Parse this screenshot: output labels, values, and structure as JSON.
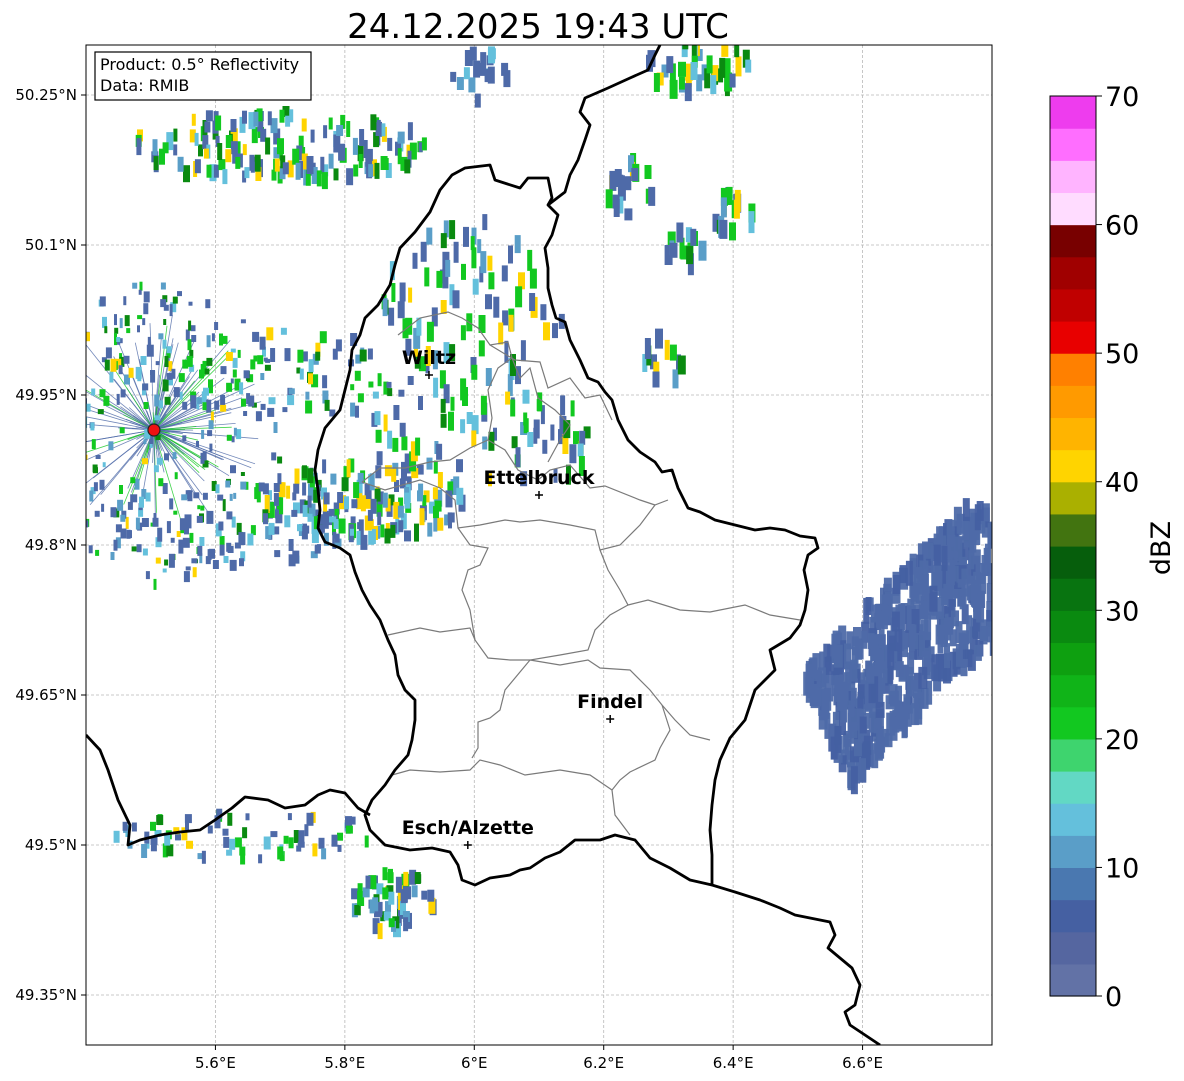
{
  "title": "24.12.2025 19:43 UTC",
  "info_box": {
    "product": "Product: 0.5° Reflectivity",
    "data": "Data: RMIB"
  },
  "axes": {
    "lon_ticks": [
      {
        "value": 5.6,
        "label": "5.6°E"
      },
      {
        "value": 5.8,
        "label": "5.8°E"
      },
      {
        "value": 6.0,
        "label": "6°E"
      },
      {
        "value": 6.2,
        "label": "6.2°E"
      },
      {
        "value": 6.4,
        "label": "6.4°E"
      },
      {
        "value": 6.6,
        "label": "6.6°E"
      }
    ],
    "lat_ticks": [
      {
        "value": 50.25,
        "label": "50.25°N"
      },
      {
        "value": 50.1,
        "label": "50.1°N"
      },
      {
        "value": 49.95,
        "label": "49.95°N"
      },
      {
        "value": 49.8,
        "label": "49.8°N"
      },
      {
        "value": 49.65,
        "label": "49.65°N"
      },
      {
        "value": 49.5,
        "label": "49.5°N"
      },
      {
        "value": 49.35,
        "label": "49.35°N"
      }
    ],
    "lon_range": [
      5.4,
      6.8
    ],
    "lat_range": [
      49.3,
      50.3
    ]
  },
  "cities": [
    {
      "name": "Wiltz",
      "lon": 5.93,
      "lat": 49.97
    },
    {
      "name": "Ettelbruck",
      "lon": 6.1,
      "lat": 49.85
    },
    {
      "name": "Findel",
      "lon": 6.21,
      "lat": 49.626
    },
    {
      "name": "Esch/Alzette",
      "lon": 5.99,
      "lat": 49.5
    }
  ],
  "radar_site": {
    "lon": 5.505,
    "lat": 49.915,
    "color": "#ee1111"
  },
  "colorbar": {
    "label": "dBZ",
    "min": 0,
    "max": 70,
    "ticks": [
      {
        "value": 0,
        "label": "0"
      },
      {
        "value": 10,
        "label": "10"
      },
      {
        "value": 20,
        "label": "20"
      },
      {
        "value": 30,
        "label": "30"
      },
      {
        "value": 40,
        "label": "40"
      },
      {
        "value": 50,
        "label": "50"
      },
      {
        "value": 60,
        "label": "60"
      },
      {
        "value": 70,
        "label": "70"
      }
    ],
    "colors": [
      "#6272a6",
      "#5566a0",
      "#4560a2",
      "#4a78b0",
      "#5a9ec8",
      "#64c0dc",
      "#62d8c4",
      "#3ed46e",
      "#12c820",
      "#10b418",
      "#0ea010",
      "#0a8a10",
      "#087410",
      "#065e0c",
      "#427410",
      "#aab000",
      "#ffd400",
      "#ffb400",
      "#ff9a00",
      "#ff8000",
      "#e80000",
      "#c00000",
      "#a00000",
      "#780000",
      "#ffdcff",
      "#ffb4ff",
      "#ff6eff",
      "#ee3cee"
    ]
  },
  "echo_colors": {
    "weak": "#4e6aa8",
    "light": "#5a9ec8",
    "cyan": "#64c0dc",
    "green": "#12c820",
    "dark_green": "#0a8a10",
    "yellow": "#ffd400",
    "red": "#c00000"
  }
}
